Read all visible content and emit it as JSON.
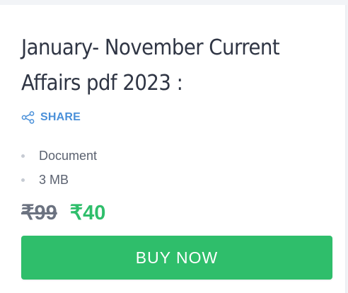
{
  "product": {
    "title": "January- November Current Affairs pdf 2023 :",
    "share_label": "SHARE",
    "meta": [
      {
        "label": "Document"
      },
      {
        "label": "3 MB"
      }
    ],
    "price_original": "₹99",
    "price_sale": "₹40",
    "buy_label": "BUY NOW"
  },
  "colors": {
    "accent_green": "#2fbe6b",
    "link_blue": "#4a90d9",
    "title_text": "#2f3544"
  },
  "icons": {
    "share": "share-icon"
  }
}
